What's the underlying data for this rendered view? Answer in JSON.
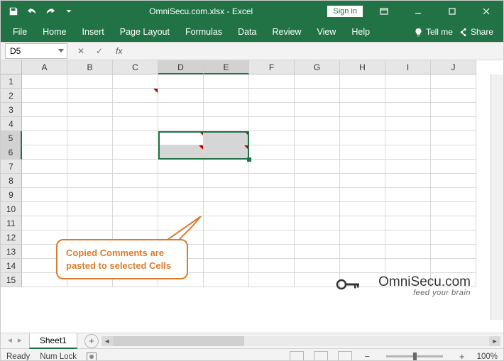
{
  "title": {
    "filename": "OmniSecu.com.xlsx",
    "sep": " - ",
    "app": "Excel"
  },
  "signin": "Sign in",
  "ribbon_tabs": [
    "File",
    "Home",
    "Insert",
    "Page Layout",
    "Formulas",
    "Data",
    "Review",
    "View",
    "Help"
  ],
  "ribbon_right": {
    "tellme": "Tell me",
    "share": "Share"
  },
  "namebox": "D5",
  "fx": "fx",
  "columns": [
    "A",
    "B",
    "C",
    "D",
    "E",
    "F",
    "G",
    "H",
    "I",
    "J"
  ],
  "rows": [
    "1",
    "2",
    "3",
    "4",
    "5",
    "6",
    "7",
    "8",
    "9",
    "10",
    "11",
    "12",
    "13",
    "14",
    "15"
  ],
  "selected_cols": [
    "D",
    "E"
  ],
  "selected_rows": [
    "5",
    "6"
  ],
  "active_cell": "D5",
  "comment_cells": [
    "C2",
    "D5",
    "E5",
    "D6",
    "E6"
  ],
  "callout": "Copied Comments are pasted to selected Cells",
  "logo": {
    "main": "OmniSecu.com",
    "sub": "feed your brain"
  },
  "sheet_tab": "Sheet1",
  "status": {
    "ready": "Ready",
    "numlock": "Num Lock",
    "zoom": "100%"
  },
  "colors": {
    "brand": "#217346",
    "accent": "#d97c2f"
  }
}
